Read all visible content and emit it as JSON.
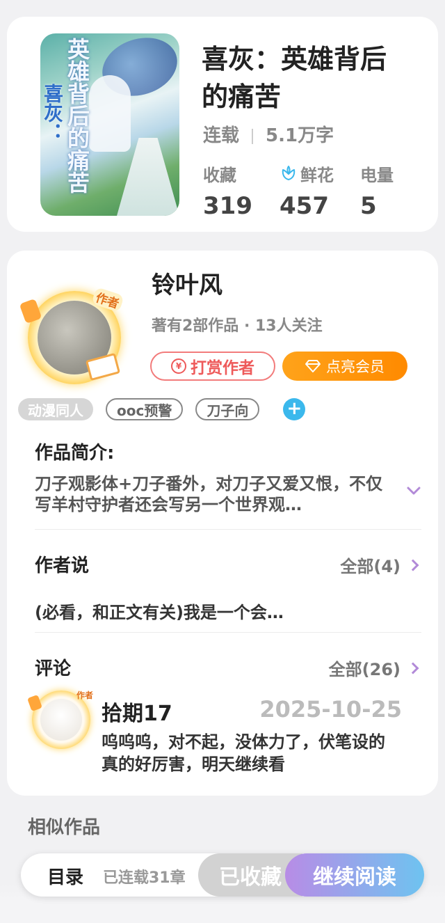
{
  "book": {
    "cover_text_top": "英雄背后的痛苦",
    "cover_text_side": "喜灰：",
    "title": "喜灰：英雄背后的痛苦",
    "status": "连载",
    "word_count": "5.1万字",
    "stats": [
      {
        "label": "收藏",
        "value": "319",
        "icon": ""
      },
      {
        "label": "鲜花",
        "value": "457",
        "icon": "flower-icon"
      },
      {
        "label": "电量",
        "value": "5",
        "icon": ""
      }
    ]
  },
  "author": {
    "badge": "作者",
    "name": "铃叶风",
    "meta": "著有2部作品 · 13人关注",
    "tip_label": "打赏作者",
    "tip_icon_text": "¥",
    "vip_label": "点亮会员"
  },
  "tags": {
    "items": [
      "动漫同人",
      "ooc预警",
      "刀子向"
    ],
    "add_label": "+"
  },
  "intro": {
    "title": "作品简介:",
    "text": "刀子观影体+刀子番外，对刀子又爱又恨，不仅写羊村守护者还会写另一个世界观…"
  },
  "author_says": {
    "title": "作者说",
    "more": "全部(4)",
    "text": "(必看，和正文有关)我是一个会…"
  },
  "comments": {
    "title": "评论",
    "more": "全部(26)",
    "item": {
      "badge": "作者",
      "user": "拾期17",
      "date": "2025-10-25",
      "text": "呜呜呜，对不起，没体力了，伏笔设的真的好厉害，明天继续看"
    }
  },
  "similar": {
    "title": "相似作品"
  },
  "bottom_bar": {
    "toc": "目录",
    "chapters": "已连载31章",
    "collected": "已收藏",
    "continue": "继续阅读"
  },
  "colors": {
    "accent_purple": "#b28ad8",
    "tip_red": "#ee5a5a",
    "vip_orange": "#ff8a00",
    "plus_blue": "#3bb8ec"
  }
}
